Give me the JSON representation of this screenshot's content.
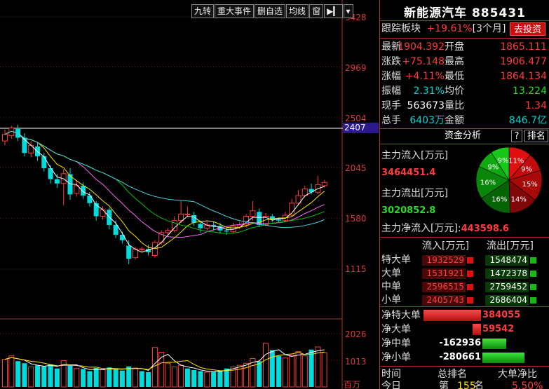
{
  "toolbar": {
    "items": [
      "九转",
      "重大事件",
      "删自选",
      "均线",
      "窗"
    ]
  },
  "axis": {
    "price_ticks": [
      "3428",
      "2969",
      "2504",
      "2045",
      "1580",
      "1115"
    ],
    "volume_ticks": [
      "2026",
      "1013",
      "百万"
    ],
    "current_tag": "2407"
  },
  "chart_data": {
    "type": "candlestick",
    "ylim": [
      1115,
      3428
    ],
    "volume_ylim": [
      0,
      2026
    ],
    "candles": [
      [
        2290,
        2350,
        2395,
        2250
      ],
      [
        2340,
        2410,
        2430,
        2310
      ],
      [
        2400,
        2320,
        2440,
        2290
      ],
      [
        2320,
        2180,
        2360,
        2150
      ],
      [
        2180,
        2250,
        2290,
        2140
      ],
      [
        2240,
        2150,
        2280,
        2110
      ],
      [
        2150,
        2040,
        2180,
        2010
      ],
      [
        2040,
        1940,
        2070,
        1900
      ],
      [
        1940,
        1900,
        1990,
        1860
      ],
      [
        1900,
        1990,
        2030,
        1700
      ],
      [
        1985,
        1800,
        2040,
        1750
      ],
      [
        1810,
        1880,
        1930,
        1780
      ],
      [
        1880,
        1790,
        1910,
        1760
      ],
      [
        1790,
        1720,
        1820,
        1690
      ],
      [
        1720,
        1600,
        1740,
        1560
      ],
      [
        1600,
        1660,
        1690,
        1570
      ],
      [
        1660,
        1520,
        1680,
        1480
      ],
      [
        1520,
        1430,
        1560,
        1400
      ],
      [
        1430,
        1380,
        1460,
        1350
      ],
      [
        1330,
        1210,
        1380,
        1160
      ],
      [
        1220,
        1300,
        1320,
        1200
      ],
      [
        1300,
        1300,
        1320,
        1270
      ],
      [
        1300,
        1270,
        1340,
        1240
      ],
      [
        1240,
        1360,
        1380,
        1220
      ],
      [
        1360,
        1450,
        1470,
        1340
      ],
      [
        1450,
        1470,
        1490,
        1420
      ],
      [
        1470,
        1560,
        1600,
        1450
      ],
      [
        1560,
        1620,
        1740,
        1540
      ],
      [
        1620,
        1620,
        1690,
        1590
      ],
      [
        1610,
        1540,
        1640,
        1510
      ],
      [
        1530,
        1490,
        1560,
        1450
      ],
      [
        1490,
        1520,
        1550,
        1470
      ],
      [
        1520,
        1510,
        1550,
        1470
      ],
      [
        1510,
        1470,
        1540,
        1440
      ],
      [
        1470,
        1460,
        1500,
        1430
      ],
      [
        1460,
        1510,
        1540,
        1440
      ],
      [
        1500,
        1520,
        1550,
        1480
      ],
      [
        1520,
        1600,
        1620,
        1500
      ],
      [
        1600,
        1650,
        1740,
        1560
      ],
      [
        1640,
        1520,
        1670,
        1500
      ],
      [
        1520,
        1600,
        1630,
        1510
      ],
      [
        1600,
        1570,
        1620,
        1550
      ],
      [
        1570,
        1560,
        1590,
        1540
      ],
      [
        1560,
        1610,
        1640,
        1550
      ],
      [
        1610,
        1720,
        1760,
        1600
      ],
      [
        1720,
        1790,
        1840,
        1700
      ],
      [
        1790,
        1850,
        1880,
        1770
      ],
      [
        1850,
        1820,
        1900,
        1800
      ],
      [
        1820,
        1890,
        1970,
        1800
      ],
      [
        1880,
        1910,
        1930,
        1860
      ]
    ],
    "volumes": [
      0,
      0,
      0,
      0,
      0,
      0,
      0,
      0,
      0,
      0,
      0,
      0,
      0,
      0,
      0,
      0,
      0,
      0,
      0,
      0,
      0,
      0,
      0,
      0,
      0,
      0,
      0,
      0,
      0,
      0,
      0,
      0,
      0,
      0,
      0,
      0,
      0,
      0,
      0,
      0,
      0,
      0,
      0,
      0,
      0,
      0,
      0,
      0,
      0,
      0
    ],
    "vol_values": [
      1050,
      1180,
      980,
      900,
      760,
      820,
      780,
      860,
      700,
      1000,
      820,
      700,
      680,
      600,
      720,
      650,
      740,
      690,
      620,
      780,
      720,
      600,
      560,
      1500,
      1320,
      900,
      760,
      820,
      700,
      640,
      600,
      560,
      580,
      620,
      700,
      760,
      820,
      900,
      1080,
      980,
      1660,
      1400,
      1180,
      1100,
      1200,
      1340,
      1180,
      1420,
      1520,
      1300
    ],
    "vol_up": [
      true,
      true,
      false,
      false,
      true,
      false,
      false,
      false,
      false,
      true,
      false,
      true,
      false,
      false,
      false,
      true,
      false,
      false,
      false,
      false,
      true,
      false,
      false,
      true,
      true,
      true,
      true,
      true,
      false,
      false,
      false,
      true,
      false,
      false,
      false,
      true,
      true,
      true,
      true,
      false,
      true,
      false,
      false,
      true,
      true,
      true,
      true,
      false,
      true,
      true
    ],
    "colors": {
      "up": "#ff3b3b",
      "down": "#00dcdc",
      "ma5": "#ffffff",
      "ma10": "#ffe100",
      "ma20": "#ff66ff",
      "ma30": "#00c400",
      "ma60": "#4ad0e0",
      "grid": "#7a1515"
    }
  },
  "panel": {
    "title": "新能源汽车 885431",
    "track": {
      "label": "跟踪板块",
      "value": "+19.61%",
      "period": "[3个月]",
      "button": "去投资"
    },
    "quote": [
      {
        "l1": "最新",
        "v1": "1904.392",
        "c1": "red",
        "l2": "开盘",
        "v2": "1865.111",
        "c2": "red"
      },
      {
        "l1": "涨跌",
        "v1": "+75.148",
        "c1": "red",
        "l2": "最高",
        "v2": "1906.477",
        "c2": "red"
      },
      {
        "l1": "涨幅",
        "v1": "+4.11%",
        "c1": "red",
        "l2": "最低",
        "v2": "1864.134",
        "c2": "red"
      },
      {
        "l1": "振幅",
        "v1": "2.31%",
        "c1": "cyan",
        "l2": "均价",
        "v2": "13.224",
        "c2": "green"
      },
      {
        "l1": "现手",
        "v1": "563673",
        "c1": "white",
        "l2": "量比",
        "v2": "1.34",
        "c2": "red"
      },
      {
        "l1": "总手",
        "v1": "6403万",
        "c1": "cyan",
        "l2": "金额",
        "v2": "846.7亿",
        "c2": "cyan"
      }
    ],
    "fund_tab": "资金分析",
    "help": "?",
    "rank_tab": "排名",
    "main_in_label": "主力流入[万元]",
    "main_in_value": "3464451.4",
    "main_out_label": "主力流出[万元]",
    "main_out_value": "3020852.8",
    "main_net_label": "主力净流入[万元]:",
    "main_net_value": "443598.6",
    "pie": {
      "slices": [
        {
          "label": "11%",
          "value": 11,
          "color": "#e01010"
        },
        {
          "label": "9%",
          "value": 9,
          "color": "#c00c0c"
        },
        {
          "label": "15%",
          "value": 15,
          "color": "#a80a0a"
        },
        {
          "label": "14%",
          "value": 14,
          "color": "#800808"
        },
        {
          "label": "16%",
          "value": 16,
          "color": "#066306"
        },
        {
          "label": "16%",
          "value": 16,
          "color": "#0a860a"
        },
        {
          "label": "9%",
          "value": 9,
          "color": "#10a910"
        },
        {
          "label": "9%",
          "value": 9,
          "color": "#18c818"
        }
      ]
    },
    "flow_headers": {
      "in": "流入[万元]",
      "out": "流出[万元]"
    },
    "flows": [
      {
        "label": "特大单",
        "in": "1932529",
        "out": "1548474"
      },
      {
        "label": "大单",
        "in": "1531921",
        "out": "1472378"
      },
      {
        "label": "中单",
        "in": "2596515",
        "out": "2759452"
      },
      {
        "label": "小单",
        "in": "2405743",
        "out": "2686404"
      }
    ],
    "nets": [
      {
        "label": "净特大单",
        "value": "384055",
        "sign": "pos",
        "bar": 1.0
      },
      {
        "label": "净大单",
        "value": "59542",
        "sign": "pos",
        "bar": 0.15
      },
      {
        "label": "净中单",
        "value": "-162936",
        "sign": "neg",
        "bar": 0.42
      },
      {
        "label": "净小单",
        "value": "-280661",
        "sign": "neg",
        "bar": 0.73
      }
    ],
    "bottom": {
      "h1": "时间",
      "h2": "总排名",
      "h3": "大单净比",
      "r1": "今日",
      "r2a": "第",
      "r2b": "155",
      "r2c": "名",
      "r3": "5.50%"
    }
  }
}
